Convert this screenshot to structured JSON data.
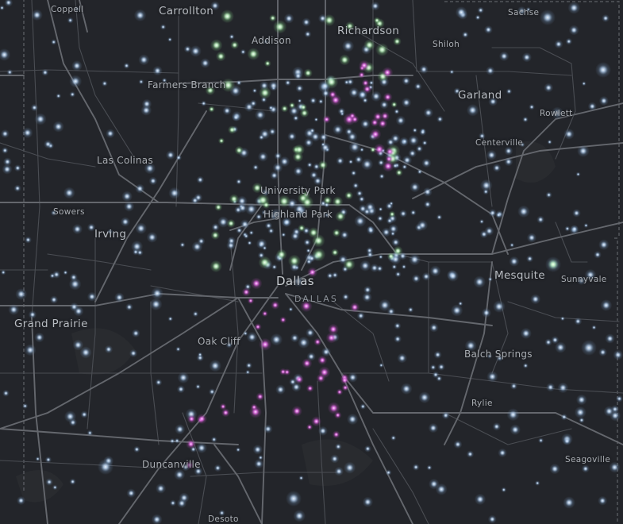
{
  "map": {
    "colors": {
      "background": "#23252a",
      "road": "#5b5e64",
      "road_major": "#6a6d73",
      "water": "#2a2d31",
      "dot_blue": "#b9d3f0",
      "dot_green": "#c4f5c6",
      "dot_magenta": "#ea72ec"
    },
    "places": [
      {
        "id": "coppell",
        "label": "Coppell",
        "size": "s"
      },
      {
        "id": "carrollton",
        "label": "Carrollton",
        "size": "l"
      },
      {
        "id": "addison",
        "label": "Addison",
        "size": "m"
      },
      {
        "id": "richardson",
        "label": "Richardson",
        "size": "l"
      },
      {
        "id": "sachse",
        "label": "Sachse",
        "size": "s"
      },
      {
        "id": "shiloh",
        "label": "Shiloh",
        "size": "s"
      },
      {
        "id": "farmers-branch",
        "label": "Farmers Branch",
        "size": "m"
      },
      {
        "id": "garland",
        "label": "Garland",
        "size": "l"
      },
      {
        "id": "rowlett",
        "label": "Rowlett",
        "size": "s"
      },
      {
        "id": "centerville",
        "label": "Centerville",
        "size": "s"
      },
      {
        "id": "las-colinas",
        "label": "Las Colinas",
        "size": "m"
      },
      {
        "id": "university-park",
        "label": "University Park",
        "size": "m"
      },
      {
        "id": "highland-park",
        "label": "Highland Park",
        "size": "m"
      },
      {
        "id": "sowers",
        "label": "Sowers",
        "size": "s"
      },
      {
        "id": "irving",
        "label": "Irving",
        "size": "l"
      },
      {
        "id": "dallas",
        "label": "Dallas",
        "size": "xl"
      },
      {
        "id": "dallas-county",
        "label": "DALLAS",
        "size": "district"
      },
      {
        "id": "mesquite",
        "label": "Mesquite",
        "size": "l"
      },
      {
        "id": "sunnyvale",
        "label": "Sunnyvale",
        "size": "s"
      },
      {
        "id": "grand-prairie",
        "label": "Grand Prairie",
        "size": "l"
      },
      {
        "id": "oak-cliff",
        "label": "Oak Cliff",
        "size": "m"
      },
      {
        "id": "balch-springs",
        "label": "Balch Springs",
        "size": "m"
      },
      {
        "id": "rylie",
        "label": "Rylie",
        "size": "s"
      },
      {
        "id": "seagoville",
        "label": "Seagoville",
        "size": "s"
      },
      {
        "id": "duncanville",
        "label": "Duncanville",
        "size": "m"
      },
      {
        "id": "desoto",
        "label": "Desoto",
        "size": "s"
      }
    ]
  }
}
